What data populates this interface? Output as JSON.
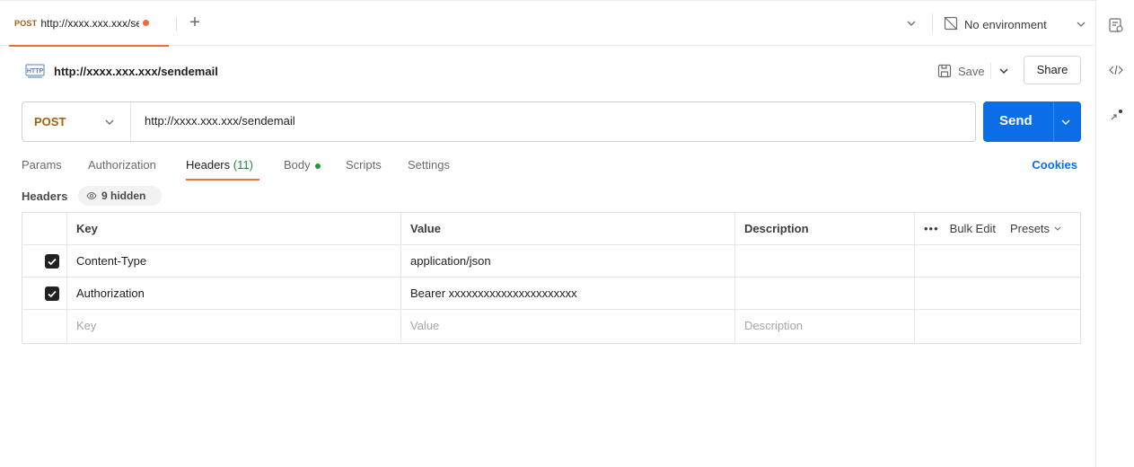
{
  "tab": {
    "method": "POST",
    "url": "http://xxxx.xxx.xxx/ser",
    "new_tab_label": "+"
  },
  "environment": {
    "label": "No environment"
  },
  "request": {
    "title": "http://xxxx.xxx.xxx/sendemail",
    "save_label": "Save",
    "share_label": "Share",
    "method": "POST",
    "url": "http://xxxx.xxx.xxx/sendemail",
    "send_label": "Send"
  },
  "subtabs": {
    "params": "Params",
    "authorization": "Authorization",
    "headers": "Headers",
    "headers_count": "(11)",
    "body": "Body",
    "scripts": "Scripts",
    "settings": "Settings",
    "cookies": "Cookies"
  },
  "headers_section": {
    "label": "Headers",
    "hidden_label": "9 hidden"
  },
  "table": {
    "columns": {
      "key": "Key",
      "value": "Value",
      "description": "Description"
    },
    "more_label": "•••",
    "bulk_edit": "Bulk Edit",
    "presets": "Presets",
    "rows": [
      {
        "checked": true,
        "key": "Content-Type",
        "value": "application/json",
        "description": ""
      },
      {
        "checked": true,
        "key": "Authorization",
        "value": "Bearer xxxxxxxxxxxxxxxxxxxxxx",
        "description": ""
      }
    ],
    "placeholder": {
      "key": "Key",
      "value": "Value",
      "description": "Description"
    }
  },
  "colors": {
    "accent": "#f26b3a",
    "send_button": "#0b6ee6",
    "method_post": "#a0620b",
    "body_dot": "#1a9a3a"
  }
}
